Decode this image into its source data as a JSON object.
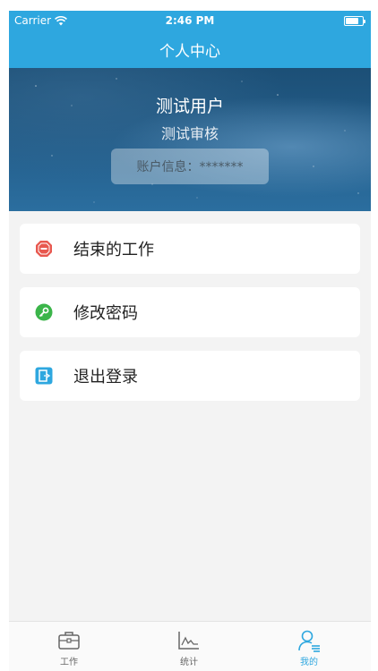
{
  "status_bar": {
    "carrier": "Carrier",
    "time": "2:46 PM",
    "battery_level": 0.7
  },
  "nav": {
    "title": "个人中心"
  },
  "profile": {
    "name": "测试用户",
    "role": "测试审核",
    "account_info": "账户信息：*******"
  },
  "menu": {
    "items": [
      {
        "label": "结束的工作",
        "icon": "stop-octagon-icon",
        "color": "#e8584f"
      },
      {
        "label": "修改密码",
        "icon": "key-icon",
        "color": "#3bb54a"
      },
      {
        "label": "退出登录",
        "icon": "logout-door-icon",
        "color": "#2ea7df"
      }
    ]
  },
  "tabs": [
    {
      "label": "工作",
      "icon": "briefcase-icon",
      "active": false
    },
    {
      "label": "统计",
      "icon": "line-chart-icon",
      "active": false
    },
    {
      "label": "我的",
      "icon": "user-profile-icon",
      "active": true
    }
  ],
  "colors": {
    "primary": "#2ea7df",
    "background": "#f3f3f3"
  }
}
